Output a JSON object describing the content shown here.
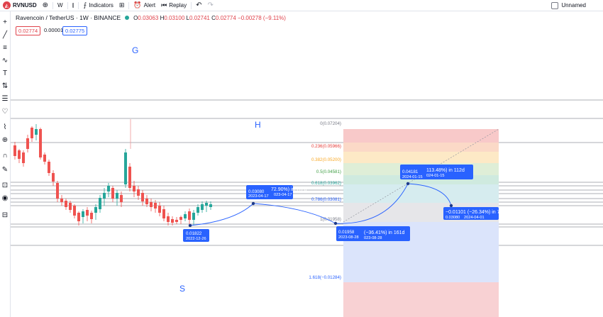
{
  "toolbar": {
    "symbol": "RVNUSD",
    "interval": "W",
    "indicators_label": "Indicators",
    "alert_label": "Alert",
    "replay_label": "Replay",
    "layout_name": "Unnamed"
  },
  "legend": {
    "title": "Ravencoin / TetherUS · 1W · BINANCE",
    "o_label": "O",
    "o_value": "0.03063",
    "h_label": "H",
    "h_value": "0.03100",
    "l_label": "L",
    "l_value": "0.02741",
    "c_label": "C",
    "c_value": "0.02774",
    "change": "−0.00278 (−9.11%)"
  },
  "order_boxes": {
    "sell": "0.02774",
    "spread": "0.00001",
    "buy": "0.02775"
  },
  "annotations": {
    "g": "G",
    "h": "H",
    "s": "S"
  },
  "fib": {
    "levels": [
      {
        "label": "0(0.07204)",
        "color": "#787b86"
      },
      {
        "label": "0.236(0.05966)",
        "color": "#e53935"
      },
      {
        "label": "0.382(0.05200)",
        "color": "#f9a825"
      },
      {
        "label": "0.5(0.04581)",
        "color": "#43a047"
      },
      {
        "label": "0.618(0.03962)",
        "color": "#26a69a"
      },
      {
        "label": "0.786(0.03081)",
        "color": "#2962ff"
      },
      {
        "label": "1(0.01958)",
        "color": "#787b86"
      },
      {
        "label": "1.618(−0.01284)",
        "color": "#2962ff"
      }
    ]
  },
  "measure_tags": {
    "t1_price": "0.01822",
    "t1_date": "2022-12-26",
    "t2_price": "0.03080",
    "t2_date": "2023-04-17",
    "t2_change": "72.90%) in 112d",
    "t2_date2": "023-04-17",
    "t3_price": "0.01958",
    "t3_date": "2023-08-28",
    "t3_change": "(−36.41%) in 161d",
    "t3_date2": "023-08-28",
    "t4_price": "0.04181",
    "t4_date": "2024-01-15",
    "t4_change": "113.48%) in 112d",
    "t4_date2": "024-01-15",
    "t5_change": "−0.01101 (−26.34%) in 77d",
    "t5_price": "0.03080",
    "t5_date": "2024-04-01"
  },
  "colors": {
    "up": "#26a69a",
    "down": "#ef5350",
    "accent": "#2962ff"
  }
}
